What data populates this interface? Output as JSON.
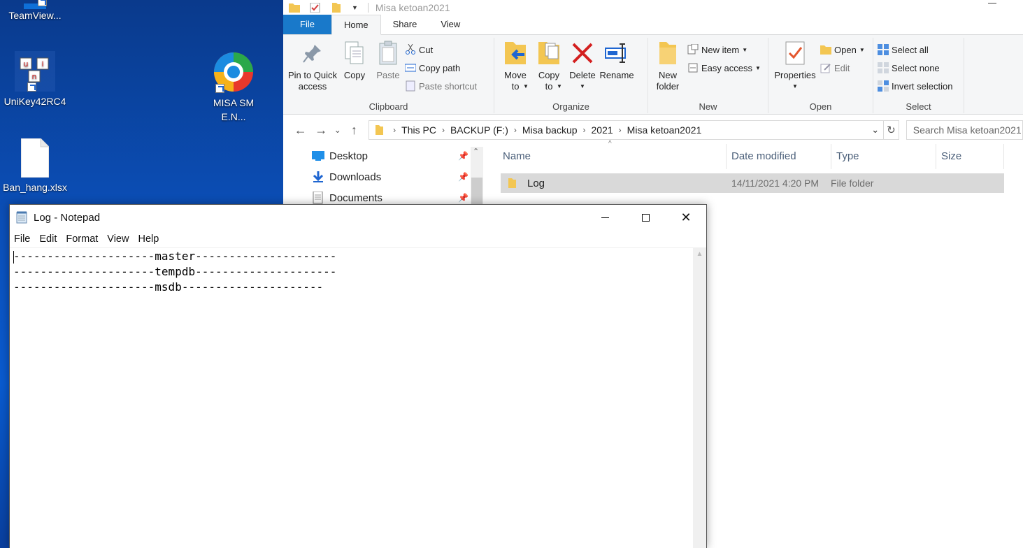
{
  "desktop": {
    "icons": [
      {
        "label": "TeamView..."
      },
      {
        "label": "UniKey42RC4"
      },
      {
        "label": "MISA SME.N..."
      },
      {
        "label": "Ban_hang.xlsx"
      }
    ]
  },
  "explorer": {
    "title": "Misa ketoan2021",
    "tabs": [
      "File",
      "Home",
      "Share",
      "View"
    ],
    "ribbon": {
      "clipboard": {
        "label": "Clipboard",
        "pin": "Pin to Quick access",
        "copy": "Copy",
        "paste": "Paste",
        "cut": "Cut",
        "copy_path": "Copy path",
        "paste_shortcut": "Paste shortcut"
      },
      "organize": {
        "label": "Organize",
        "move_to": "Move to",
        "copy_to": "Copy to",
        "delete": "Delete",
        "rename": "Rename"
      },
      "new": {
        "label": "New",
        "new_folder": "New folder",
        "new_item": "New item",
        "easy_access": "Easy access"
      },
      "open": {
        "label": "Open",
        "properties": "Properties",
        "open": "Open",
        "edit": "Edit"
      },
      "select": {
        "label": "Select",
        "select_all": "Select all",
        "select_none": "Select none",
        "invert": "Invert selection"
      }
    },
    "breadcrumb": [
      "This PC",
      "BACKUP (F:)",
      "Misa backup",
      "2021",
      "Misa ketoan2021"
    ],
    "search_placeholder": "Search Misa ketoan2021",
    "nav_items": [
      "Desktop",
      "Downloads",
      "Documents"
    ],
    "columns": [
      "Name",
      "Date modified",
      "Type",
      "Size"
    ],
    "files": [
      {
        "name": "Log",
        "date": "14/11/2021 4:20 PM",
        "type": "File folder",
        "size": ""
      }
    ]
  },
  "notepad": {
    "title": "Log - Notepad",
    "menu": [
      "File",
      "Edit",
      "Format",
      "View",
      "Help"
    ],
    "lines": [
      "---------------------master---------------------",
      "---------------------tempdb---------------------",
      "---------------------msdb---------------------"
    ]
  },
  "colors": {
    "file_tab": "#1979ca",
    "selected_row": "#d9d9d9",
    "desktop_bg": "#0b4fb8"
  }
}
